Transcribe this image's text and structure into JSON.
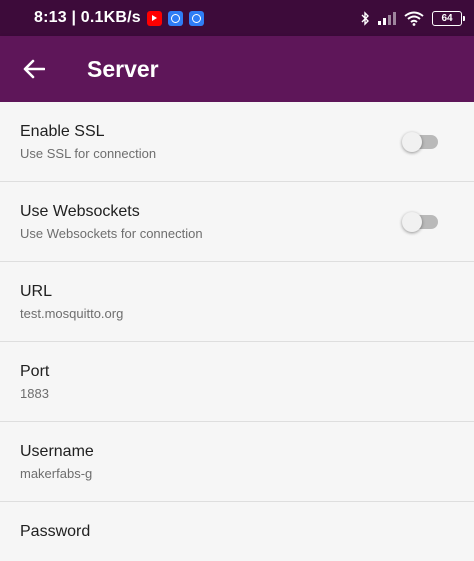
{
  "status_bar": {
    "time": "8:13",
    "speed": "0.1KB/s",
    "notification_icons": [
      "youtube-icon",
      "app-icon",
      "app-icon"
    ],
    "battery_level": "64",
    "indicators": [
      "bluetooth-icon",
      "signal-icon",
      "wifi-icon",
      "battery-icon"
    ]
  },
  "app_bar": {
    "title": "Server",
    "back_icon": "arrow-left-icon",
    "color": "#5e1659"
  },
  "settings": [
    {
      "title": "Enable SSL",
      "summary": "Use SSL for connection",
      "type": "switch",
      "checked": false
    },
    {
      "title": "Use Websockets",
      "summary": "Use Websockets for connection",
      "type": "switch",
      "checked": false
    },
    {
      "title": "URL",
      "summary": "test.mosquitto.org",
      "type": "text"
    },
    {
      "title": "Port",
      "summary": "1883",
      "type": "text"
    },
    {
      "title": "Username",
      "summary": "makerfabs-g",
      "type": "text"
    },
    {
      "title": "Password",
      "summary": "",
      "type": "text"
    }
  ]
}
